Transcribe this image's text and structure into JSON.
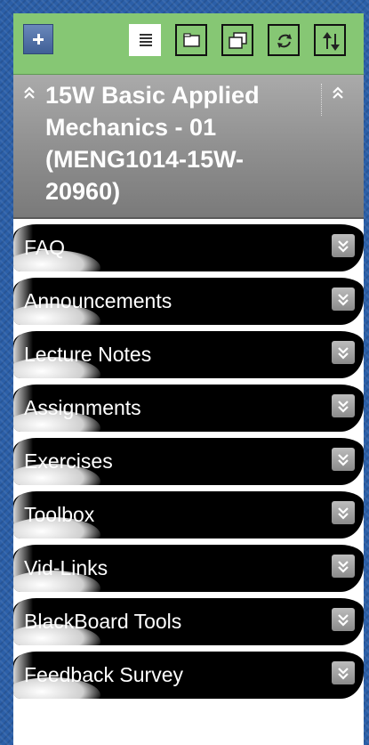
{
  "toolbar": {
    "add_icon": "plus-icon",
    "buttons": [
      {
        "name": "list-view",
        "icon": "list-icon",
        "active": true
      },
      {
        "name": "folder-view",
        "icon": "folder-icon",
        "active": false
      },
      {
        "name": "window-view",
        "icon": "window-icon",
        "active": false
      },
      {
        "name": "refresh",
        "icon": "refresh-icon",
        "active": false
      },
      {
        "name": "reorder",
        "icon": "sort-arrows-icon",
        "active": false
      }
    ],
    "colors": {
      "background": "#86c774",
      "add_button": "#4f6fa6"
    }
  },
  "course": {
    "title_line1": "15W Basic Applied",
    "title_line2": "Mechanics - 01",
    "title_line3": "(MENG1014-15W-",
    "title_line4": "20960)",
    "collapse_icon": "double-chevron-up-icon"
  },
  "menu": {
    "items": [
      {
        "label": "FAQ"
      },
      {
        "label": "Announcements"
      },
      {
        "label": "Lecture Notes"
      },
      {
        "label": "Assignments"
      },
      {
        "label": "Exercises"
      },
      {
        "label": "Toolbox"
      },
      {
        "label": "Vid-Links"
      },
      {
        "label": "BlackBoard Tools"
      },
      {
        "label": "Feedback Survey"
      }
    ],
    "expand_icon": "double-chevron-down-icon"
  }
}
